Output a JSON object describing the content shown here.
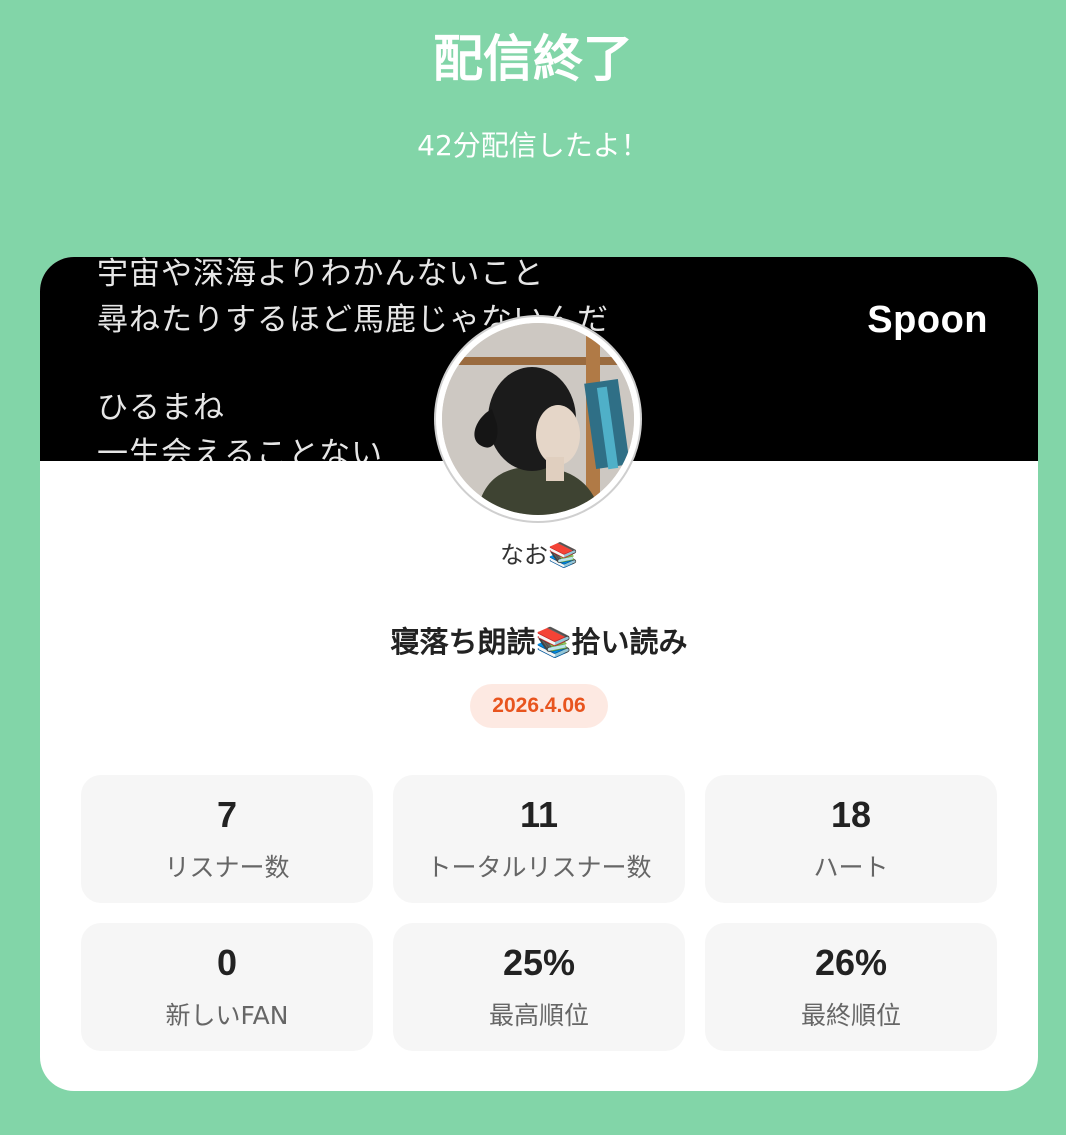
{
  "header": {
    "title": "配信終了",
    "subtitle": "42分配信したよ！"
  },
  "card": {
    "banner_lyrics": [
      "宇宙や深海よりわかんないこと",
      "尋ねたりするほど馬鹿じゃないんだ",
      "ひるまね",
      "一生会えることない"
    ],
    "brand": "Spoon",
    "username": "なお📚",
    "stream_title": "寝落ち朗読📚拾い読み",
    "date": "2026.4.06"
  },
  "stats": [
    {
      "value": "7",
      "label": "リスナー数"
    },
    {
      "value": "11",
      "label": "トータルリスナー数"
    },
    {
      "value": "18",
      "label": "ハート"
    },
    {
      "value": "0",
      "label": "新しいFAN"
    },
    {
      "value": "25%",
      "label": "最高順位"
    },
    {
      "value": "26%",
      "label": "最終順位"
    }
  ],
  "colors": {
    "background": "#82d5a8",
    "date_text": "#e8541e",
    "date_badge": "#fde9e2"
  }
}
